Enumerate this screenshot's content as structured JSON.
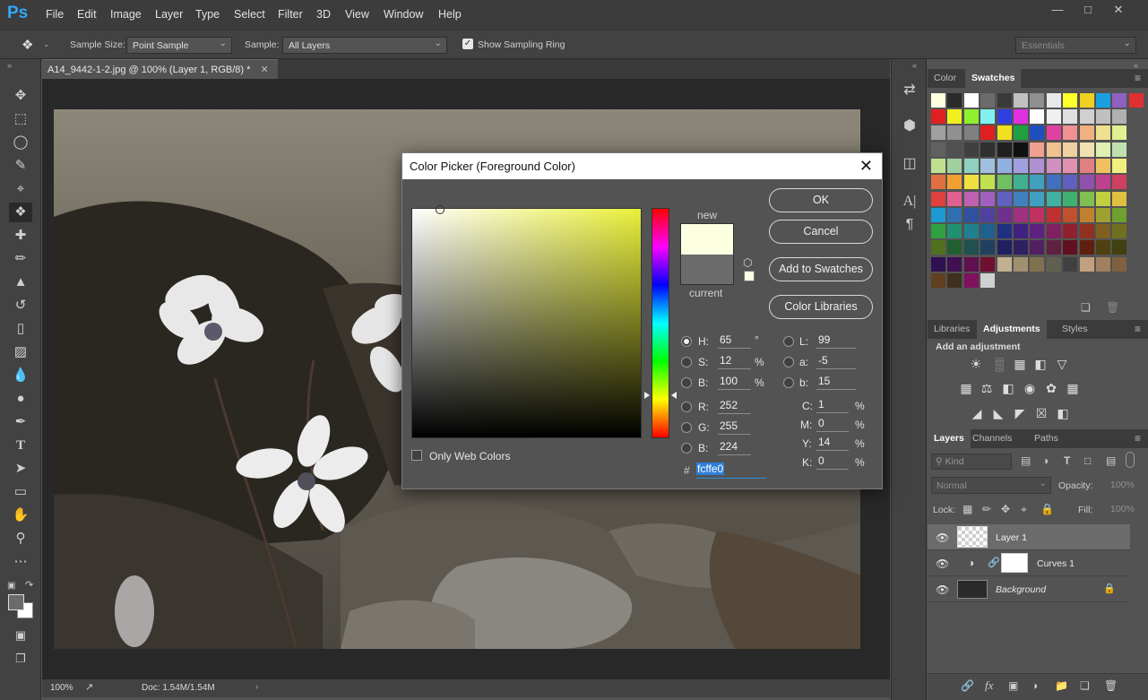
{
  "app": {
    "logo": "Ps"
  },
  "menu": [
    "File",
    "Edit",
    "Image",
    "Layer",
    "Type",
    "Select",
    "Filter",
    "3D",
    "View",
    "Window",
    "Help"
  ],
  "options": {
    "sample_size_label": "Sample Size:",
    "sample_size_value": "Point Sample",
    "sample_label": "Sample:",
    "sample_value": "All Layers",
    "show_ring_label": "Show Sampling Ring",
    "show_ring_checked": true,
    "workspace": "Essentials"
  },
  "document": {
    "tab_title": "A14_9442-1-2.jpg @ 100% (Layer 1, RGB/8) *",
    "zoom": "100%",
    "doc_size": "Doc: 1.54M/1.54M"
  },
  "color_picker": {
    "title": "Color Picker (Foreground Color)",
    "ok": "OK",
    "cancel": "Cancel",
    "add_to_swatches": "Add to Swatches",
    "color_libraries": "Color Libraries",
    "new_label": "new",
    "current_label": "current",
    "new_color": "#fcffe0",
    "current_color": "#6b6b6b",
    "only_web_colors": "Only Web Colors",
    "fields": {
      "H": {
        "label": "H:",
        "value": "65",
        "unit": "°"
      },
      "S": {
        "label": "S:",
        "value": "12",
        "unit": "%"
      },
      "Bv": {
        "label": "B:",
        "value": "100",
        "unit": "%"
      },
      "R": {
        "label": "R:",
        "value": "252"
      },
      "G": {
        "label": "G:",
        "value": "255"
      },
      "Bc": {
        "label": "B:",
        "value": "224"
      },
      "L": {
        "label": "L:",
        "value": "99"
      },
      "a": {
        "label": "a:",
        "value": "-5"
      },
      "b": {
        "label": "b:",
        "value": "15"
      },
      "C": {
        "label": "C:",
        "value": "1",
        "unit": "%"
      },
      "M": {
        "label": "M:",
        "value": "0",
        "unit": "%"
      },
      "Y": {
        "label": "Y:",
        "value": "14",
        "unit": "%"
      },
      "K": {
        "label": "K:",
        "value": "0",
        "unit": "%"
      }
    },
    "hex_label": "#",
    "hex_value": "fcffe0",
    "hue_color": "#eaf03a"
  },
  "panels": {
    "color_tabs": [
      "Color",
      "Swatches"
    ],
    "adj_tabs": [
      "Libraries",
      "Adjustments",
      "Styles"
    ],
    "add_adjustment": "Add an adjustment",
    "layers_tabs": [
      "Layers",
      "Channels",
      "Paths"
    ],
    "kind_label": "Kind",
    "blend_mode": "Normal",
    "opacity_label": "Opacity:",
    "opacity_value": "100%",
    "lock_label": "Lock:",
    "fill_label": "Fill:",
    "fill_value": "100%"
  },
  "layers": [
    {
      "name": "Layer 1",
      "selected": true
    },
    {
      "name": "Curves 1",
      "selected": false
    },
    {
      "name": "Background",
      "selected": false
    }
  ],
  "swatch_rows": [
    [
      "#ffffe0",
      "#2b2b2b",
      "#ffffff",
      "#6b6b6b",
      "#3a3a3a",
      "#c0c0c0",
      "#8f8f8f",
      "#e8e8e8",
      "#ffff2a",
      "#f0d020",
      "#1aa0e0",
      "#9060c0",
      "#e03030"
    ],
    [
      "#e02020",
      "#f0f020",
      "#90f030",
      "#80f0f0",
      "#3040e0",
      "#e030e0",
      "#ffffff",
      "#f0f0f0",
      "#e0e0e0",
      "#d0d0d0",
      "#c0c0c0",
      "#b0b0b0"
    ],
    [
      "#a0a0a0",
      "#909090",
      "#808080",
      "#e02020",
      "#f0e020",
      "#20a040",
      "#2050c0",
      "#e040a0",
      "#f09090",
      "#f0b080",
      "#f0e090",
      "#e0f090"
    ],
    [
      "#606060",
      "#505050",
      "#404040",
      "#303030",
      "#202020",
      "#101010",
      "#f0a090",
      "#f0c090",
      "#f0d0a0",
      "#f0e0b0",
      "#e0f0b0",
      "#c0e0b0"
    ],
    [
      "#c0e090",
      "#a0d0a0",
      "#90d0c0",
      "#a0c0e0",
      "#90b0e0",
      "#a0a0e0",
      "#b090d0",
      "#d090c0",
      "#e090b0",
      "#e08080",
      "#f0c060",
      "#f0f080"
    ],
    [
      "#e07040",
      "#f0a030",
      "#f0e040",
      "#c0e050",
      "#70c060",
      "#40b090",
      "#40a0c0",
      "#4070c0",
      "#6060c0",
      "#9050b0",
      "#c04090",
      "#d04060"
    ],
    [
      "#e04040",
      "#e06090",
      "#c060b0",
      "#a060c0",
      "#6060c0",
      "#4080c0",
      "#40a0c0",
      "#40b0a0",
      "#40b070",
      "#80c050",
      "#c0d040",
      "#e0c040"
    ],
    [
      "#1a9ad0",
      "#3070b0",
      "#3050a0",
      "#5040a0",
      "#703090",
      "#a03080",
      "#c03060",
      "#c03030",
      "#c05030",
      "#c08030",
      "#a0a030",
      "#70a030"
    ],
    [
      "#30a040",
      "#209070",
      "#208090",
      "#206090",
      "#203080",
      "#402080",
      "#602080",
      "#802060",
      "#902030",
      "#903020",
      "#806020",
      "#707020"
    ],
    [
      "#507020",
      "#206030",
      "#205050",
      "#204060",
      "#202060",
      "#302060",
      "#502060",
      "#602040",
      "#601020",
      "#602010",
      "#504010",
      "#404010"
    ],
    [
      "#301050",
      "#401050",
      "#601050",
      "#701030",
      "#c0b090",
      "#a09070",
      "#807050",
      "#606050",
      "#404040",
      "#c0a080",
      "#a08060",
      "#806040"
    ],
    [
      "#604020",
      "#403020",
      "#801060",
      "#d0d0d0"
    ]
  ]
}
